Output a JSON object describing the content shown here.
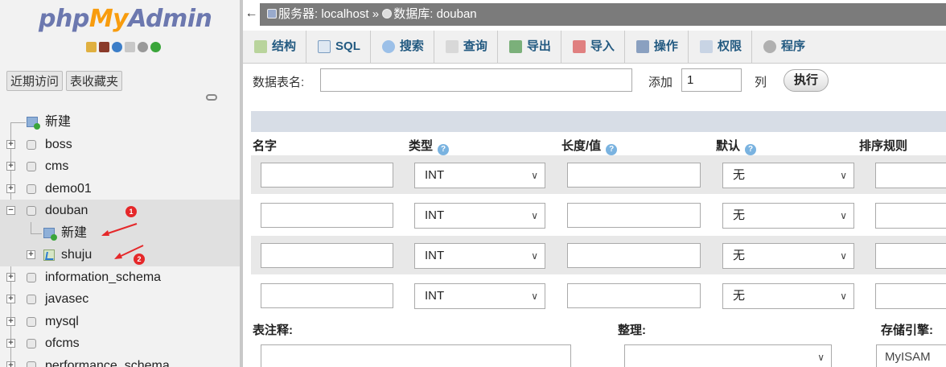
{
  "logo": {
    "part1": "php",
    "part2": "My",
    "part3": "Admin"
  },
  "nav_tabs": [
    "近期访问",
    "表收藏夹"
  ],
  "tree": {
    "new_label": "新建",
    "databases": [
      "boss",
      "cms",
      "demo01",
      "douban"
    ],
    "douban_children": {
      "new_label": "新建",
      "table": "shuju"
    },
    "more_databases": [
      "information_schema",
      "javasec",
      "mysql",
      "ofcms",
      "performance_schema"
    ]
  },
  "annotations": [
    "1",
    "2"
  ],
  "breadcrumb": {
    "server_label": "服务器: localhost",
    "sep": "»",
    "db_label": "数据库: douban"
  },
  "menu": [
    "结构",
    "SQL",
    "搜索",
    "查询",
    "导出",
    "导入",
    "操作",
    "权限",
    "程序"
  ],
  "create_form": {
    "table_name_label": "数据表名:",
    "table_name_value": "",
    "add_label": "添加",
    "add_count": "1",
    "columns_label": "列",
    "execute_label": "执行"
  },
  "columns": {
    "name": "名字",
    "type": "类型",
    "length": "长度/值",
    "default": "默认",
    "collation": "排序规则"
  },
  "rows": [
    {
      "type": "INT",
      "default": "无"
    },
    {
      "type": "INT",
      "default": "无"
    },
    {
      "type": "INT",
      "default": "无"
    },
    {
      "type": "INT",
      "default": "无"
    }
  ],
  "bottom": {
    "comment_label": "表注释:",
    "collation_label": "整理:",
    "engine_label": "存储引擎:",
    "engine_value": "MyISAM"
  },
  "colors": {
    "accent": "#235a81",
    "topbar": "#7b7b7b",
    "band": "#d7dde6",
    "badge": "#e5282a"
  }
}
